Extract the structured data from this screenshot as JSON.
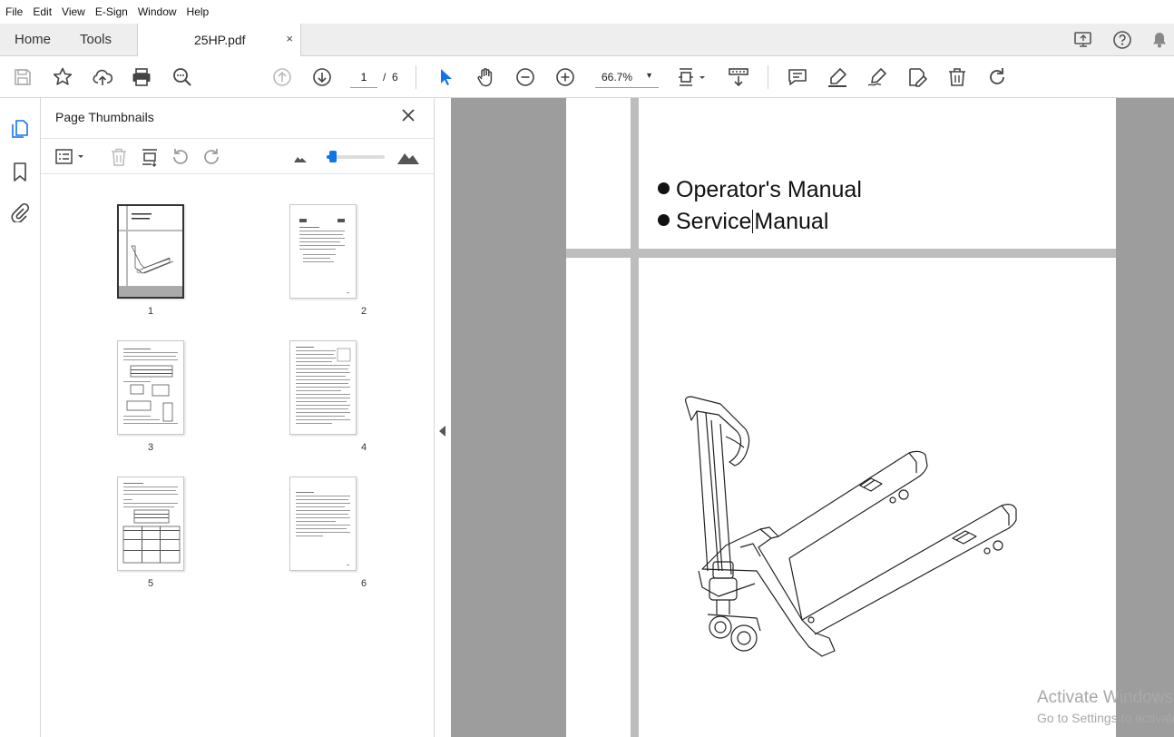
{
  "menubar": {
    "items": [
      "File",
      "Edit",
      "View",
      "E-Sign",
      "Window",
      "Help"
    ]
  },
  "tabs": {
    "home": "Home",
    "tools": "Tools",
    "document": "25HP.pdf",
    "close": "×"
  },
  "toolbar": {
    "page_current": "1",
    "page_sep": "/",
    "page_total": "6",
    "zoom": "66.7%",
    "zoom_caret": "▼"
  },
  "panel": {
    "title": "Page Thumbnails",
    "thumbnails": [
      {
        "label": "1",
        "selected": true
      },
      {
        "label": "2",
        "selected": false
      },
      {
        "label": "3",
        "selected": false
      },
      {
        "label": "4",
        "selected": false
      },
      {
        "label": "5",
        "selected": false
      },
      {
        "label": "6",
        "selected": false
      }
    ],
    "thumbnail_size_level": 0.05
  },
  "document": {
    "line1": "Operator's Manual",
    "line2_part1": "Service",
    "line2_part2": "Manual"
  },
  "watermark": {
    "line1": "Activate Windows",
    "line2": "Go to Settings to activate Windows."
  },
  "colors": {
    "accent": "#1473e6",
    "viewer_bg": "#9d9d9d",
    "tabbar_bg": "#eeeeee"
  }
}
